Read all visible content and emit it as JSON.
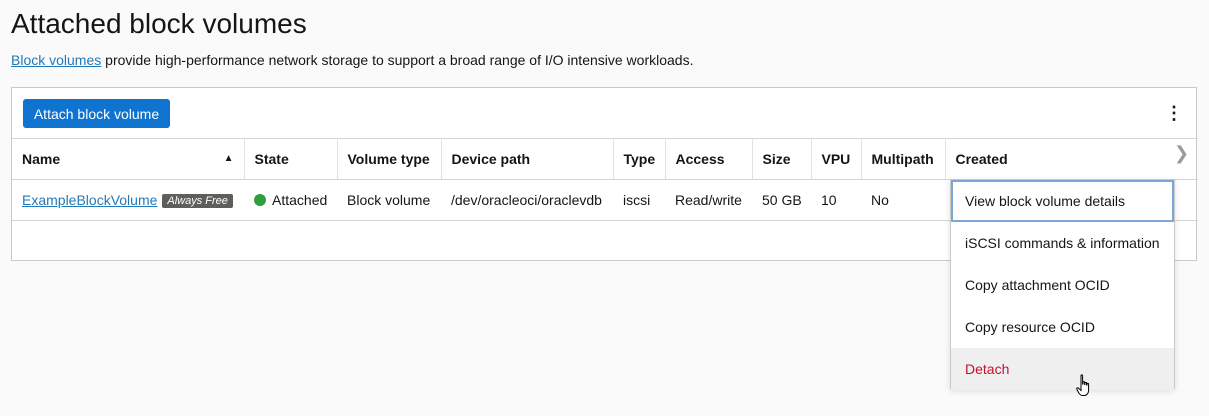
{
  "page": {
    "title": "Attached block volumes",
    "description_link": "Block volumes",
    "description_rest": " provide high-performance network storage to support a broad range of I/O intensive workloads."
  },
  "toolbar": {
    "attach_label": "Attach block volume"
  },
  "table": {
    "columns": [
      "Name",
      "State",
      "Volume type",
      "Device path",
      "Type",
      "Access",
      "Size",
      "VPU",
      "Multipath",
      "Created"
    ],
    "sort_column": "Name",
    "sort_direction": "ascending",
    "rows": [
      {
        "name": "ExampleBlockVolume",
        "badge": "Always Free",
        "state": "Attached",
        "volume_type": "Block volume",
        "device_path": "/dev/oracleoci/oraclevdb",
        "type": "iscsi",
        "access": "Read/write",
        "size": "50 GB",
        "vpu": "10",
        "multipath": "No",
        "created": ""
      }
    ]
  },
  "actions_menu": {
    "items": [
      "View block volume details",
      "iSCSI commands & information",
      "Copy attachment OCID",
      "Copy resource OCID",
      "Detach"
    ]
  },
  "icons": {
    "sort": "sort-ascending-icon",
    "kebab": "kebab-menu-icon",
    "pager": "chevron-right-icon",
    "cursor": "hand-pointer-icon",
    "state": "status-dot-icon"
  },
  "colors": {
    "primary_button": "#0e74cf",
    "link": "#227ab8",
    "state_ok": "#2d9f3e",
    "danger": "#c7102f",
    "badge_bg": "#5f5e5a"
  }
}
